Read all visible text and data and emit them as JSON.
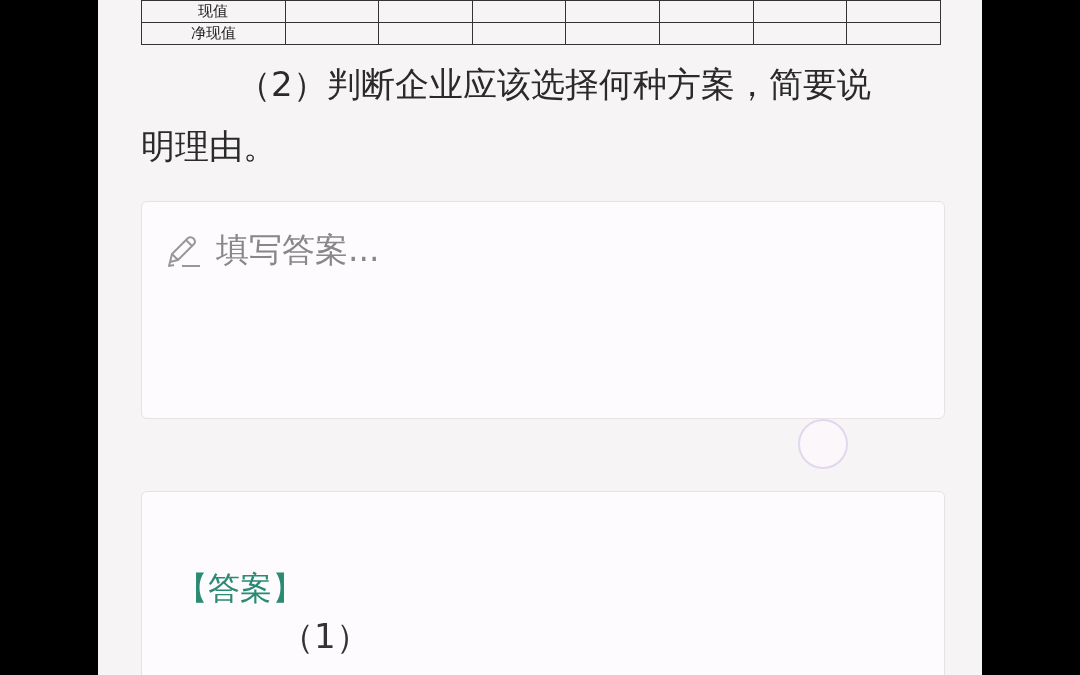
{
  "table": {
    "rows": [
      {
        "label": "现值"
      },
      {
        "label": "净现值"
      }
    ]
  },
  "question": "（2）判断企业应该选择何种方案，简要说明理由。",
  "answer_field": {
    "placeholder": "填写答案..."
  },
  "answer": {
    "heading": "【答案】",
    "lines": [
      "（1）"
    ]
  }
}
